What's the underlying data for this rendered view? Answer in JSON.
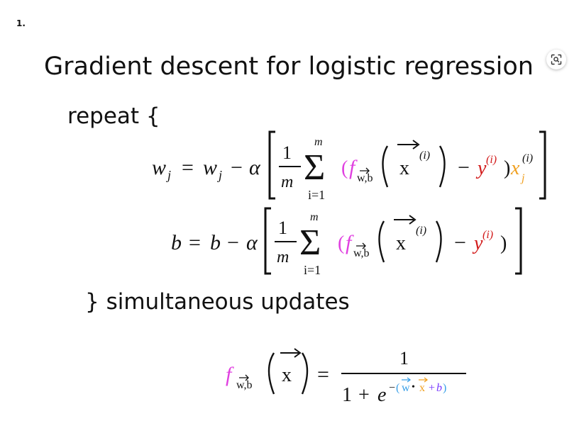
{
  "page": {
    "item_number": "1.",
    "title": "Gradient descent for logistic regression",
    "repeat_label": "repeat {",
    "closing_label": "} simultaneous updates"
  },
  "icons": {
    "visual_search": "visual-search-icon"
  },
  "colors": {
    "f_magenta": "#e040e0",
    "y_red": "#d21a1a",
    "x_orange": "#f0a020",
    "w_blue": "#3aa0e8",
    "b_purple": "#7a3cff",
    "text": "#111111"
  },
  "formula_w": {
    "lhs": "w",
    "lhs_sub": "j",
    "equals": "=",
    "rhs_w": "w",
    "rhs_w_sub": "j",
    "minus": "−",
    "alpha": "α",
    "frac_num": "1",
    "frac_den": "m",
    "sum_top": "m",
    "sum_bottom": "i=1",
    "sigma": "Σ",
    "open_paren": "(",
    "f": "f",
    "f_sub": "w,b",
    "x": "x",
    "sup_i": "(i)",
    "minus2": "−",
    "y": "y",
    "close_paren": ")",
    "xj": "x",
    "xj_sub": "j"
  },
  "formula_b": {
    "lhs": "b",
    "equals": "=",
    "rhs_b": "b",
    "minus": "−",
    "alpha": "α",
    "frac_num": "1",
    "frac_den": "m",
    "sum_top": "m",
    "sum_bottom": "i=1",
    "sigma": "Σ",
    "open_paren": "(",
    "f": "f",
    "f_sub": "w,b",
    "x": "x",
    "sup_i": "(i)",
    "minus2": "−",
    "y": "y",
    "close_paren": ")"
  },
  "formula_f": {
    "f": "f",
    "f_sub": "w,b",
    "x": "x",
    "equals": "=",
    "numerator": "1",
    "den_one": "1",
    "den_plus": "+",
    "den_e": "e",
    "exp_minus": "−",
    "exp_open": "(",
    "exp_w": "w",
    "exp_dot": "•",
    "exp_x": "x",
    "exp_plus": "+",
    "exp_b": "b",
    "exp_close": ")"
  }
}
